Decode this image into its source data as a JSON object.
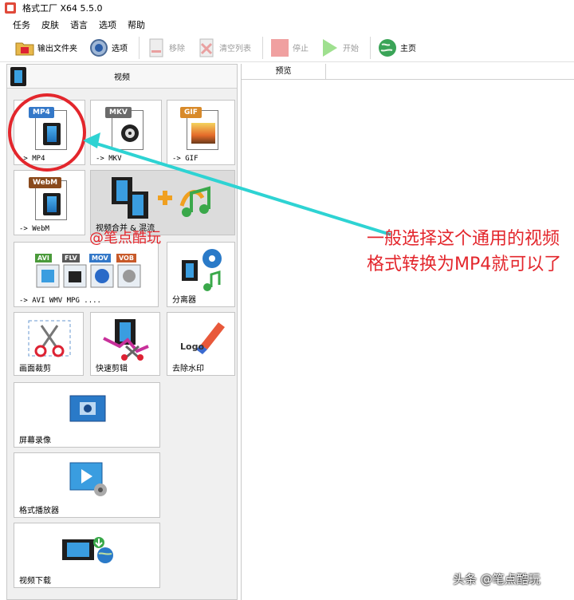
{
  "window": {
    "title": "格式工厂 X64 5.5.0"
  },
  "menu": [
    "任务",
    "皮肤",
    "语言",
    "选项",
    "帮助"
  ],
  "toolbar": {
    "output_folder": "输出文件夹",
    "options": "选项",
    "remove": "移除",
    "clear_list": "清空列表",
    "stop": "停止",
    "start": "开始",
    "home": "主页"
  },
  "left_panel": {
    "header": "视频",
    "tiles": {
      "mp4": {
        "label": "-> MP4",
        "tag": "MP4"
      },
      "mkv": {
        "label": "-> MKV",
        "tag": "MKV"
      },
      "gif": {
        "label": "-> GIF",
        "tag": "GIF"
      },
      "webm": {
        "label": "-> WebM",
        "tag": "WebM"
      },
      "merge": {
        "label": "视频合并 & 混流"
      },
      "multi": {
        "label": "-> AVI WMV MPG ....",
        "tags": [
          "AVI",
          "FLV",
          "MOV",
          "VOB"
        ]
      },
      "splitter": {
        "label": "分离器"
      },
      "crop": {
        "label": "画面裁剪"
      },
      "quick_cut": {
        "label": "快速剪辑"
      },
      "remove_watermark": {
        "label": "去除水印",
        "logo_text": "Logo"
      },
      "screen_record": {
        "label": "屏幕录像"
      },
      "player": {
        "label": "格式播放器"
      },
      "download": {
        "label": "视频下载"
      }
    }
  },
  "right_panel": {
    "preview_header": "预览"
  },
  "annotation": {
    "text": "一般选择这个通用的视频格式转换为MP4就可以了",
    "watermark": "@笔点酷玩",
    "footer_watermark": "头条 @笔点酷玩",
    "color": "#e3262c",
    "arrow_color": "#2ed3d3"
  }
}
